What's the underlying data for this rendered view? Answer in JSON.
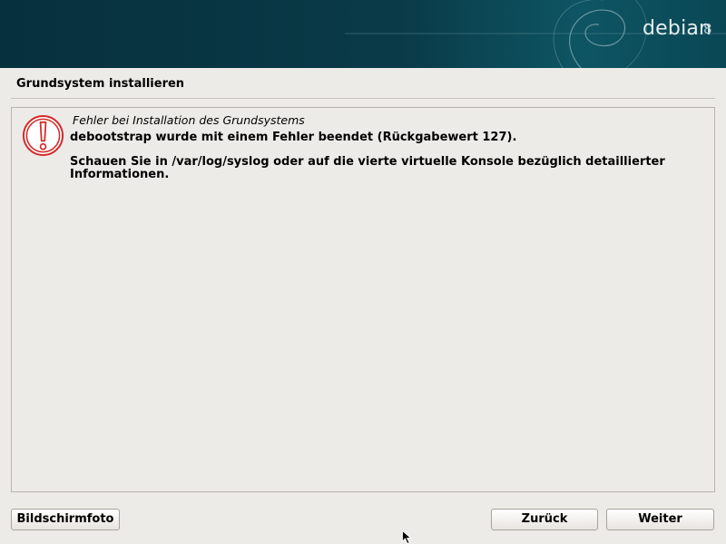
{
  "banner": {
    "brand": "debian",
    "version": "8"
  },
  "page": {
    "title": "Grundsystem installieren"
  },
  "error": {
    "heading": "Fehler bei Installation des Grundsystems",
    "message": "debootstrap wurde mit einem Fehler beendet (Rückgabewert 127).",
    "details": "Schauen Sie in /var/log/syslog oder auf die vierte virtuelle Konsole bezüglich detaillierter Informationen.",
    "icon": "error-exclamation-icon"
  },
  "buttons": {
    "screenshot": "Bildschirmfoto",
    "back": "Zurück",
    "continue": "Weiter"
  },
  "colors": {
    "banner": "#0a3a48",
    "background": "#edebe7",
    "error_red": "#d42b2b"
  }
}
